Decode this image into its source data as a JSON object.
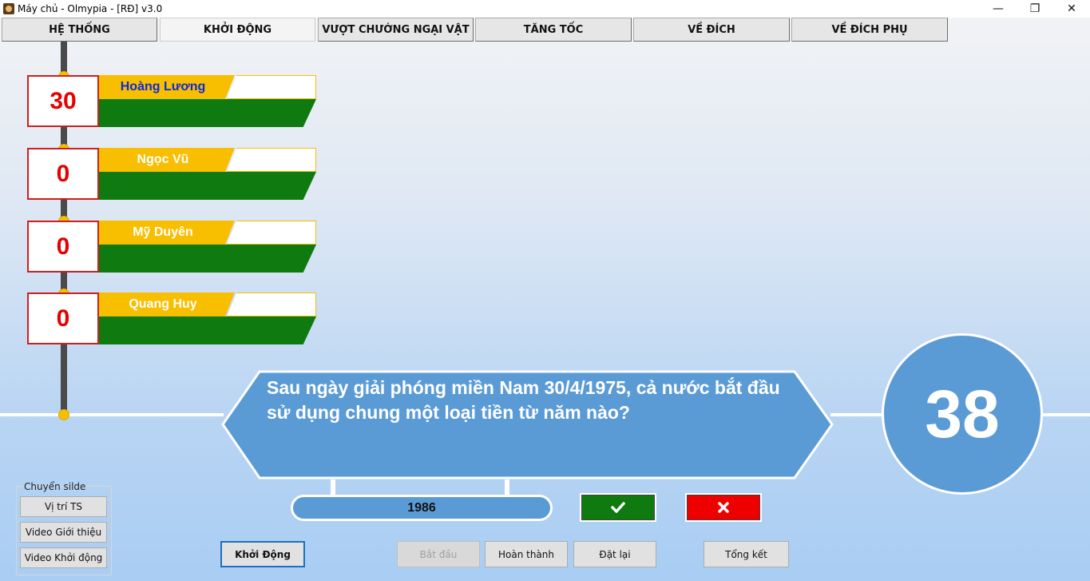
{
  "window": {
    "title": "Máy chủ - Olmypia - [RĐ] v3.0",
    "minimize_glyph": "—",
    "maximize_glyph": "❐",
    "close_glyph": "✕"
  },
  "tabs": [
    {
      "label": "HỆ THỐNG"
    },
    {
      "label": "KHỞI ĐỘNG"
    },
    {
      "label": "VƯỢT CHƯỚNG NGẠI VẬT"
    },
    {
      "label": "TĂNG TỐC"
    },
    {
      "label": "VỀ ĐÍCH"
    },
    {
      "label": "VỀ ĐÍCH PHỤ"
    }
  ],
  "active_tab": "KHỞI ĐỘNG",
  "players": [
    {
      "name": "Hoàng Lương",
      "score": "30"
    },
    {
      "name": "Ngọc Vũ",
      "score": "0"
    },
    {
      "name": "Mỹ Duyên",
      "score": "0"
    },
    {
      "name": "Quang Huy",
      "score": "0"
    }
  ],
  "question": {
    "text": "Sau ngày giải phóng miền Nam 30/4/1975, cả nước bắt đầu sử dụng chung một loại tiền từ năm nào?"
  },
  "timer": {
    "value": "38"
  },
  "answer": {
    "value": "1986"
  },
  "judge": {
    "correct_icon": "check-icon",
    "wrong_icon": "x-icon",
    "correct_color": "#0e7a10",
    "wrong_color": "#ee0000"
  },
  "slide_panel": {
    "label": "Chuyển silde",
    "buttons": [
      "Vị trí TS",
      "Video Giới thiệu",
      "Video Khởi động"
    ]
  },
  "controls": {
    "round": "Khởi Động",
    "start": "Bắt đầu",
    "finish": "Hoàn thành",
    "reset": "Đặt lại",
    "summary": "Tổng kết"
  },
  "colors": {
    "score_red": "#e60000",
    "name_yellow": "#f8be00",
    "bar_green": "#0e7a10",
    "panel_blue": "#5b9bd5",
    "rail": "#4a4a4a"
  }
}
